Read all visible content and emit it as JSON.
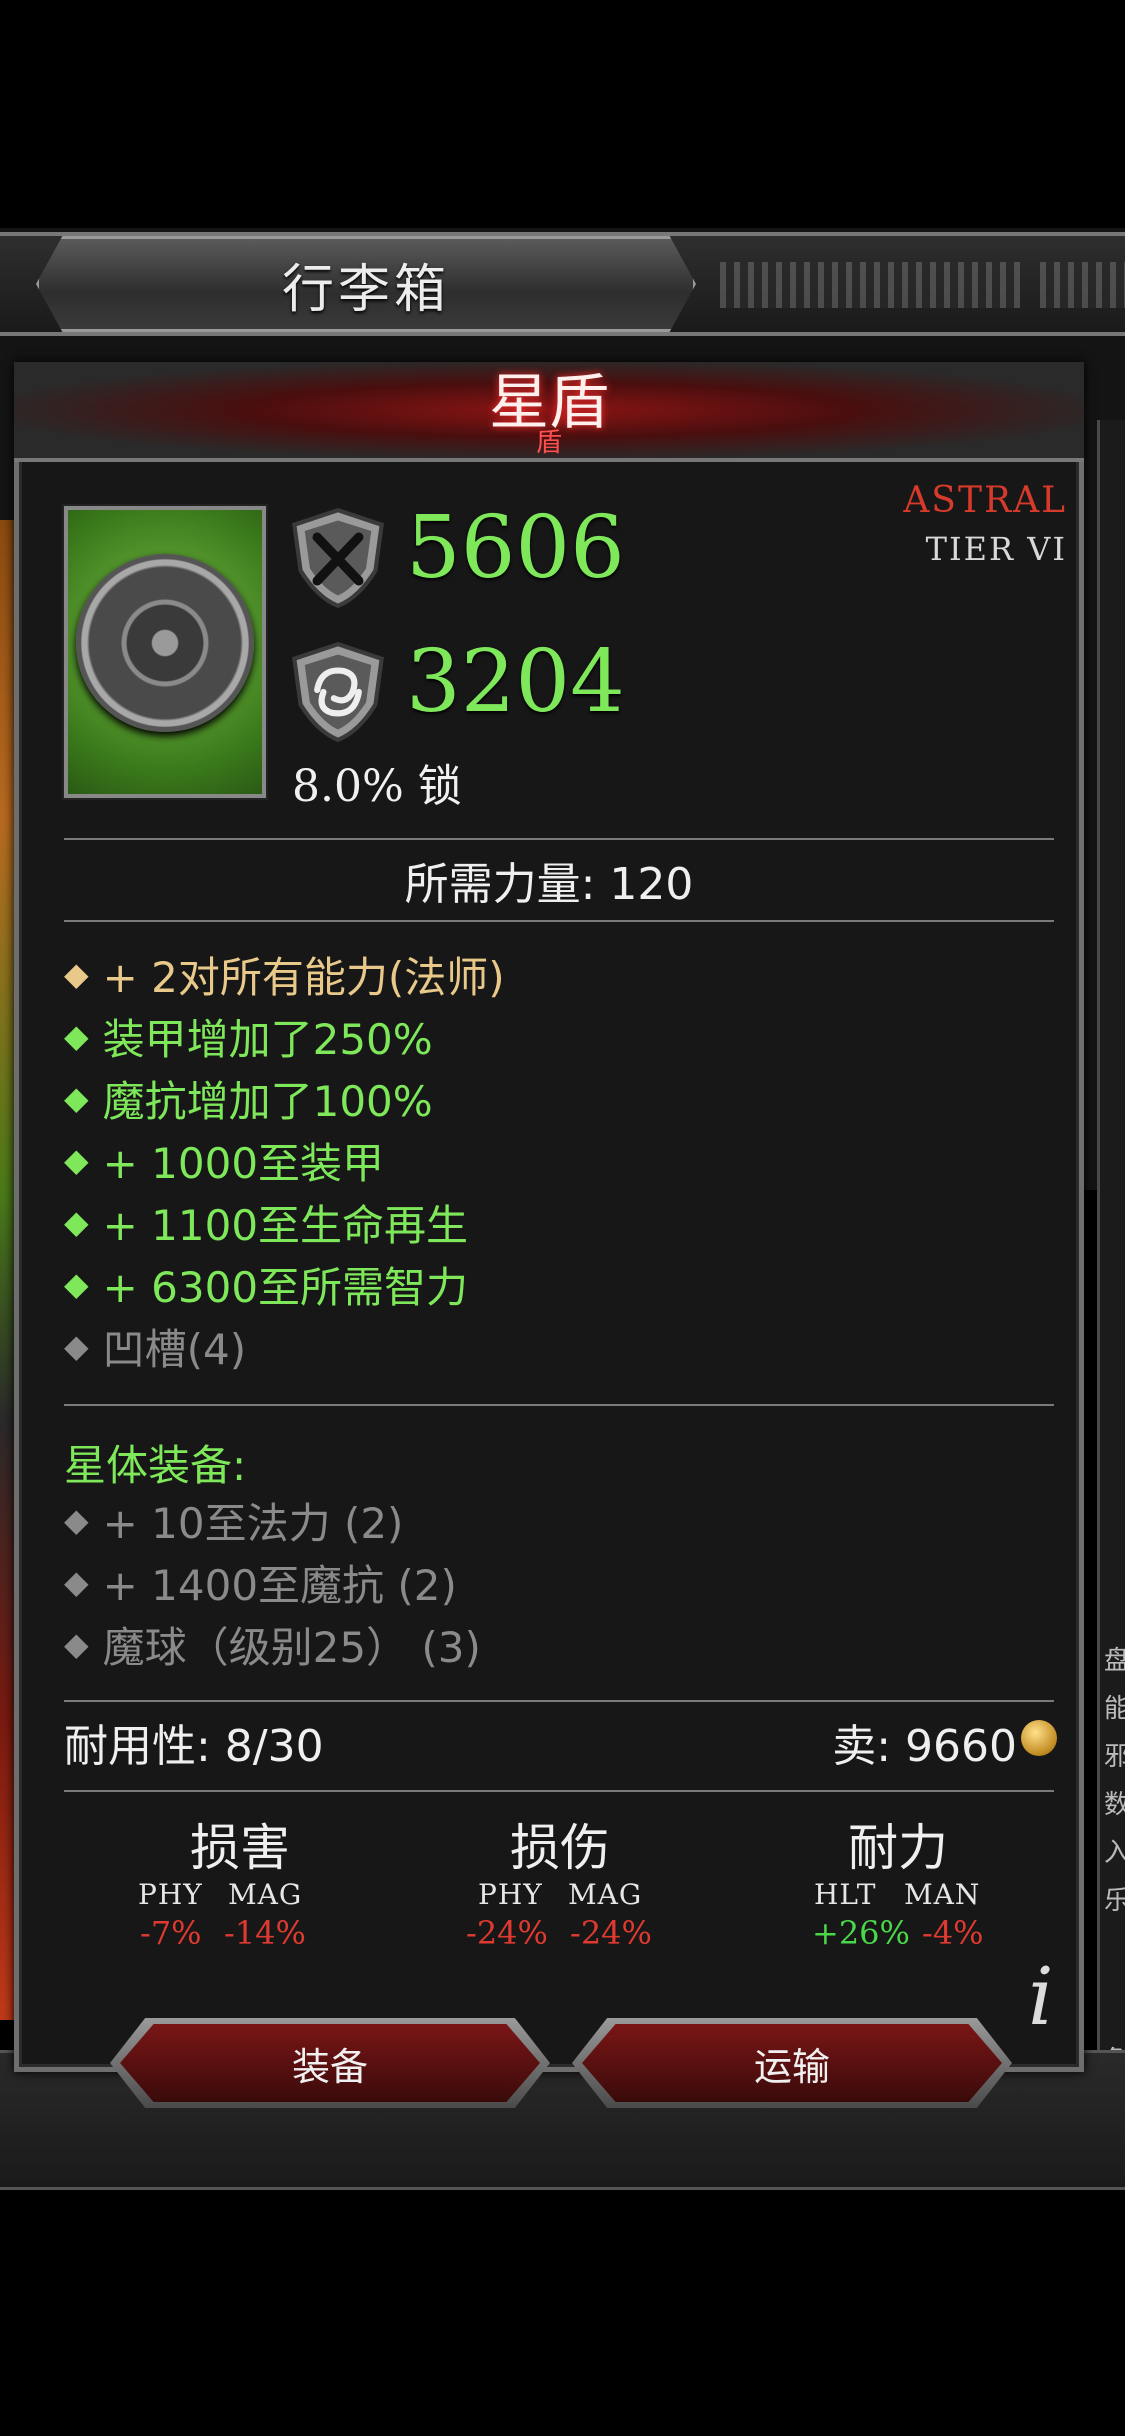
{
  "inventory": {
    "title": "行李箱"
  },
  "item": {
    "name": "星盾",
    "subname": "盾",
    "rarity": "ASTRAL",
    "tier": "TIER VI",
    "armor": "5606",
    "magic_resist": "3204",
    "block": "8.0% 锁",
    "requirement": "所需力量: 120"
  },
  "affixes": [
    {
      "text": "+ 2对所有能力(法师)",
      "color": "gold"
    },
    {
      "text": "装甲增加了250%",
      "color": "green"
    },
    {
      "text": "魔抗增加了100%",
      "color": "green"
    },
    {
      "text": "+ 1000至装甲",
      "color": "green"
    },
    {
      "text": "+ 1100至生命再生",
      "color": "green"
    },
    {
      "text": "+ 6300至所需智力",
      "color": "green"
    },
    {
      "text": "凹槽(4)",
      "color": "grey"
    }
  ],
  "set": {
    "title": "星体装备:",
    "bonuses": [
      {
        "text": "+ 10至法力 (2)"
      },
      {
        "text": "+ 1400至魔抗 (2)"
      },
      {
        "text": "魔球（级别25） (3)"
      }
    ]
  },
  "footer": {
    "durability": "耐用性: 8/30",
    "sell": "卖: 9660"
  },
  "comparison": [
    {
      "title": "损害",
      "labels": [
        "PHY",
        "MAG"
      ],
      "values": [
        "-7%",
        "-14%"
      ],
      "signs": [
        "neg",
        "neg"
      ]
    },
    {
      "title": "损伤",
      "labels": [
        "PHY",
        "MAG"
      ],
      "values": [
        "-24%",
        "-24%"
      ],
      "signs": [
        "neg",
        "neg"
      ]
    },
    {
      "title": "耐力",
      "labels": [
        "HLT",
        "MAN"
      ],
      "values": [
        "+26%",
        "-4%"
      ],
      "signs": [
        "pos",
        "neg"
      ]
    }
  ],
  "info_label": "i",
  "buttons": {
    "equip": "装备",
    "transport": "运输"
  },
  "side_text": [
    "盘",
    "能",
    "邪",
    "数",
    "入",
    "乐",
    "危"
  ],
  "icons": {
    "armor": "crossed-swords-shield-icon",
    "magic_resist": "swirl-shield-icon",
    "coin": "gold-coins-icon",
    "item": "round-shield-icon"
  },
  "colors": {
    "green": "#7ee85a",
    "gold": "#e9c98a",
    "grey": "#8a8a8a",
    "red": "#e03a30",
    "astral": "#d63a2a"
  }
}
